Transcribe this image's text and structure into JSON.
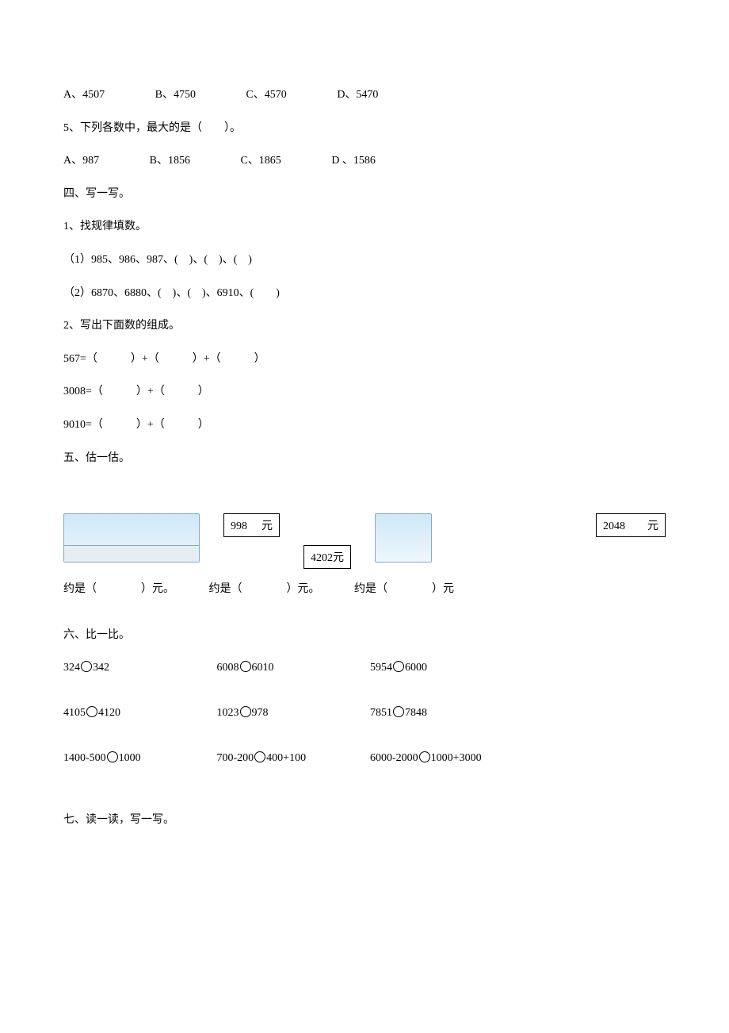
{
  "q4prev": {
    "A": "A、4507",
    "B": "B、4750",
    "C": "C、4570",
    "D": "D、5470"
  },
  "q5": {
    "stem": "5、下列各数中，最大的是（　　）。",
    "A": "A、987",
    "B": "B、1856",
    "C": "C、1865",
    "D": "D 、1586"
  },
  "sec4": {
    "title": "四、写一写。",
    "p1": "1、找规律填数。",
    "p1a": "（1）985、986、987、(　)、(　)、(　)",
    "p1b": "（2）6870、6880、(　)、(　)、6910、(　　)",
    "p2": "2、写出下面数的组成。",
    "p2a": "567=（　　　）+（　　　）+（　　　）",
    "p2b": "3008=（　　　）+（　　　）",
    "p2c": "9010=（　　　）+（　　　）"
  },
  "sec5": {
    "title": "五、估一估。",
    "price1": "998",
    "unit": "元",
    "price2": "4202元",
    "price3": "2048",
    "approx1": "约是（　　　　）元。",
    "approx2": "约是（　　　　）元。",
    "approx3": "约是（　　　　）元"
  },
  "sec6": {
    "title": "六、比一比。",
    "rows": [
      [
        "324〇342",
        "6008〇6010",
        "5954〇6000"
      ],
      [
        "4105〇4120",
        "1023〇978",
        "7851〇7848"
      ],
      [
        "1400-500〇1000",
        "700-200〇400+100",
        "6000-2000〇1000+3000"
      ]
    ],
    "display": [
      [
        "324",
        "342",
        "6008",
        "6010",
        "5954",
        "6000"
      ],
      [
        "4105",
        "4120",
        "1023",
        "978",
        "7851",
        "7848"
      ],
      [
        "1400-500",
        "1000",
        "700-200",
        "400+100",
        "6000-2000",
        "1000+3000"
      ]
    ]
  },
  "sec7": {
    "title": "七、读一读，写一写。"
  }
}
